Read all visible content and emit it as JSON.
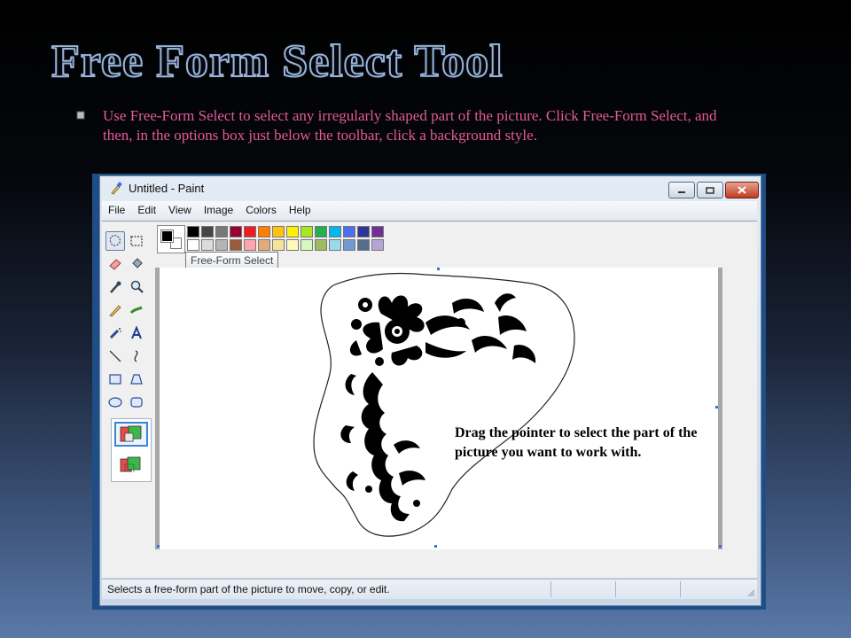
{
  "slide": {
    "title": "Free Form Select Tool",
    "bullet": "Use Free-Form Select to select any irregularly shaped part of the picture. Click Free-Form Select, and then, in the options box just below the toolbar, click a background style."
  },
  "window": {
    "title": "Untitled - Paint",
    "menu": [
      "File",
      "Edit",
      "View",
      "Image",
      "Colors",
      "Help"
    ],
    "tooltip": "Free-Form Select",
    "status": "Selects a free-form part of the picture to move, copy, or edit.",
    "annotation": "Drag the pointer to select the part of the picture you want to work with."
  },
  "tools": [
    "free-form-select",
    "select",
    "eraser",
    "fill",
    "pick-color",
    "magnifier",
    "pencil",
    "brush",
    "airbrush",
    "text",
    "line",
    "curve",
    "rectangle",
    "polygon",
    "ellipse",
    "rounded-rectangle"
  ],
  "palette": {
    "foreground": "#000000",
    "background": "#ffffff",
    "row1": [
      "#000000",
      "#464646",
      "#787878",
      "#990030",
      "#ed1c24",
      "#ff7e00",
      "#ffc20e",
      "#fff200",
      "#a8e61d",
      "#22b14c",
      "#00b7ef",
      "#4d6df3",
      "#2f3699",
      "#6f3198"
    ],
    "row2": [
      "#ffffff",
      "#dcdcdc",
      "#b4b4b4",
      "#9c5a3c",
      "#ffa3b1",
      "#e5aa7a",
      "#f5e49c",
      "#fff9bd",
      "#d3f9bc",
      "#9dbb61",
      "#99d9ea",
      "#709ad1",
      "#546d8e",
      "#b5a5d5"
    ]
  }
}
